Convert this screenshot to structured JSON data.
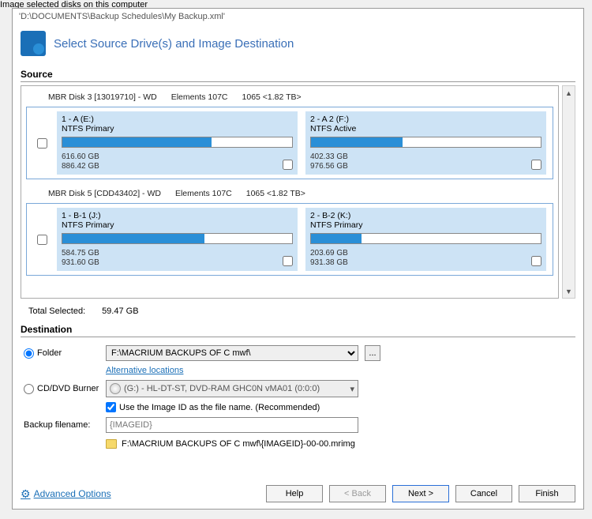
{
  "bg": "Image selected disks on this computer",
  "titlebar": "'D:\\DOCUMENTS\\Backup Schedules\\My Backup.xml'",
  "header": {
    "title": "Select Source Drive(s) and Image Destination"
  },
  "source": {
    "label": "Source",
    "disks": [
      {
        "header_parts": [
          "MBR Disk 3 [13019710] - WD",
          "Elements 107C",
          "1065  <1.82 TB>"
        ],
        "partitions": [
          {
            "title": "1 - A (E:)",
            "type": "NTFS Primary",
            "used": "616.60 GB",
            "total": "886.42 GB",
            "fill": 65
          },
          {
            "title": "2 - A 2 (F:)",
            "type": "NTFS Active",
            "used": "402.33 GB",
            "total": "976.56 GB",
            "fill": 40
          }
        ]
      },
      {
        "header_parts": [
          "MBR Disk 5 [CDD43402] - WD",
          "Elements 107C",
          "1065  <1.82 TB>"
        ],
        "partitions": [
          {
            "title": "1 - B-1 (J:)",
            "type": "NTFS Primary",
            "used": "584.75 GB",
            "total": "931.60 GB",
            "fill": 62
          },
          {
            "title": "2 - B-2 (K:)",
            "type": "NTFS Primary",
            "used": "203.69 GB",
            "total": "931.38 GB",
            "fill": 22
          }
        ]
      }
    ],
    "totals": {
      "label": "Total Selected:",
      "value": "59.47 GB"
    }
  },
  "dest": {
    "label": "Destination",
    "folder_radio": "Folder",
    "folder_value": "F:\\MACRIUM BACKUPS OF C mwf\\",
    "browse": "...",
    "alt_link": "Alternative locations",
    "cd_radio": "CD/DVD Burner",
    "burner_value": "(G:) - HL-DT-ST, DVD-RAM GHC0N    vMA01 (0:0:0)",
    "use_id": "Use the Image ID as the file name.  (Recommended)",
    "filename_label": "Backup filename:",
    "filename_value": "{IMAGEID}",
    "fullpath": "F:\\MACRIUM BACKUPS OF C mwf\\{IMAGEID}-00-00.mrimg"
  },
  "footer": {
    "adv": "Advanced Options",
    "help": "Help",
    "back": "< Back",
    "next": "Next >",
    "cancel": "Cancel",
    "finish": "Finish"
  }
}
